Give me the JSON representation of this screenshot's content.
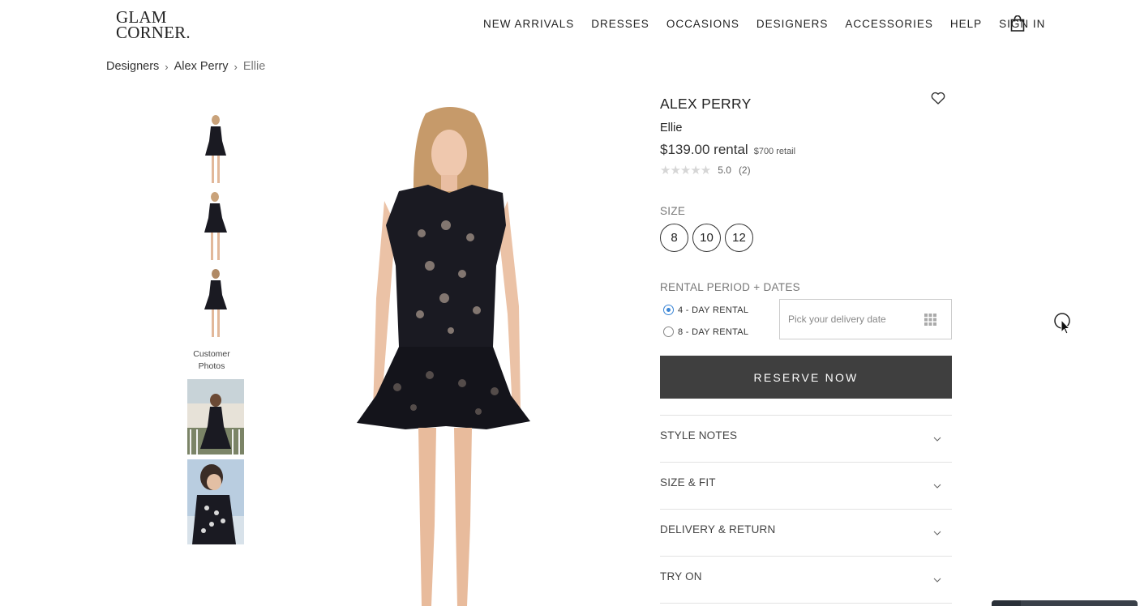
{
  "logo": {
    "line1": "GLAM",
    "line2": "CORNER."
  },
  "nav": {
    "items": [
      "NEW ARRIVALS",
      "DRESSES",
      "OCCASIONS",
      "DESIGNERS",
      "ACCESSORIES",
      "HELP",
      "SIGN IN"
    ],
    "cart_icon": "shopping-bag-icon"
  },
  "breadcrumb": {
    "items": [
      "Designers",
      "Alex Perry",
      "Ellie"
    ],
    "separator": "›"
  },
  "gallery": {
    "customer_label_line1": "Customer",
    "customer_label_line2": "Photos"
  },
  "product": {
    "brand": "ALEX PERRY",
    "name": "Ellie",
    "price": "$139.00 rental",
    "retail": "$700 retail",
    "rating_value": "5.0",
    "rating_count": "(2)",
    "stars": "★★★★★"
  },
  "size": {
    "label": "SIZE",
    "options": [
      "8",
      "10",
      "12"
    ]
  },
  "rental": {
    "label": "RENTAL PERIOD + DATES",
    "options": [
      {
        "label": "4 - DAY RENTAL",
        "checked": true
      },
      {
        "label": "8 - DAY RENTAL",
        "checked": false
      }
    ],
    "date_placeholder": "Pick your delivery date"
  },
  "reserve_label": "RESERVE NOW",
  "accordion": [
    "STYLE NOTES",
    "SIZE & FIT",
    "DELIVERY & RETURN",
    "TRY ON"
  ],
  "colors": {
    "button_bg": "#3f3f3f",
    "radio_accent": "#3b86d6",
    "dress": "#1a1a22"
  }
}
